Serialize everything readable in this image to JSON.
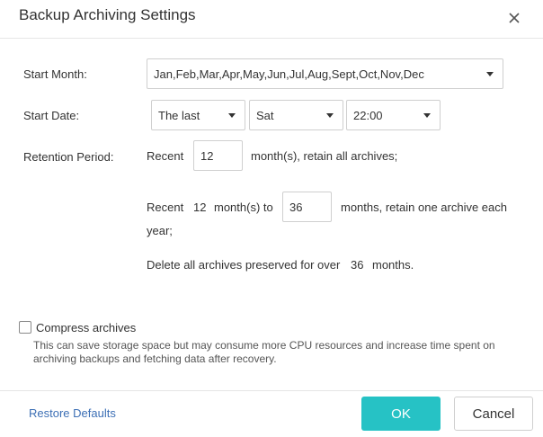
{
  "dialog": {
    "title": "Backup Archiving Settings"
  },
  "form": {
    "start_month": {
      "label": "Start Month:",
      "value": "Jan,Feb,Mar,Apr,May,Jun,Jul,Aug,Sept,Oct,Nov,Dec"
    },
    "start_date": {
      "label": "Start Date:",
      "week_value": "The last",
      "day_value": "Sat",
      "time_value": "22:00"
    },
    "retention": {
      "label": "Retention Period:",
      "line1_prefix": "Recent",
      "line1_value": "12",
      "line1_suffix": "month(s), retain all archives;",
      "line2_prefix": "Recent",
      "line2_value": "12",
      "line2_mid": "month(s) to",
      "line2_input": "36",
      "line2_suffix": "months, retain one archive each",
      "line2_wrap": "year;",
      "line3_prefix": "Delete all archives preserved for over",
      "line3_value": "36",
      "line3_suffix": "months."
    },
    "compress": {
      "label": "Compress archives",
      "checked": false,
      "note": "This can save storage space but may consume more CPU resources and increase time spent on archiving backups and fetching data after recovery."
    }
  },
  "footer": {
    "restore_label": "Restore Defaults",
    "ok_label": "OK",
    "cancel_label": "Cancel"
  },
  "colors": {
    "primary_button": "#26c2c5",
    "link": "#3c6fb5"
  }
}
